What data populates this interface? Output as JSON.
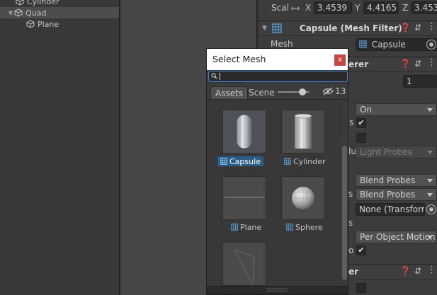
{
  "hierarchy": {
    "items": [
      {
        "label": "Cylinder"
      },
      {
        "label": "Quad"
      },
      {
        "label": "Plane"
      }
    ]
  },
  "inspector": {
    "scale": {
      "label": "Scal",
      "x_label": "X",
      "x_value": "3.4539",
      "y_label": "Y",
      "y_value": "4.4165",
      "z_label": "Z",
      "z_value": "3.4539"
    },
    "mesh_filter": {
      "title": "Capsule (Mesh Filter)",
      "mesh_label": "Mesh",
      "mesh_value": "Capsule"
    },
    "renderer": {
      "title_fragment": "erer",
      "material_count": "1",
      "cast_shadows": "On",
      "light_probes_partial": "lu",
      "light_probes_value": "Light Probes",
      "reflection_probes": "Blend Probes",
      "probe_s": "s",
      "blend_probes_2": "Blend Probes",
      "anchor_override": "None (Transform",
      "s_label": "s",
      "motion_vectors": "Per Object Motion",
      "oc_partial": "o"
    },
    "third_component": {
      "title_fragment": "er"
    }
  },
  "select_mesh": {
    "title": "Select Mesh",
    "close_label": "x",
    "tabs": [
      "Assets",
      "Scene"
    ],
    "hidden_count": "13",
    "items": [
      {
        "label": "Capsule",
        "selected": true
      },
      {
        "label": "Cylinder",
        "selected": false
      },
      {
        "label": "Plane",
        "selected": false
      },
      {
        "label": "Sphere",
        "selected": false
      }
    ]
  },
  "colors": {
    "selection": "#2c5d87",
    "close": "#c64545",
    "search_focus": "#3f89d6"
  }
}
